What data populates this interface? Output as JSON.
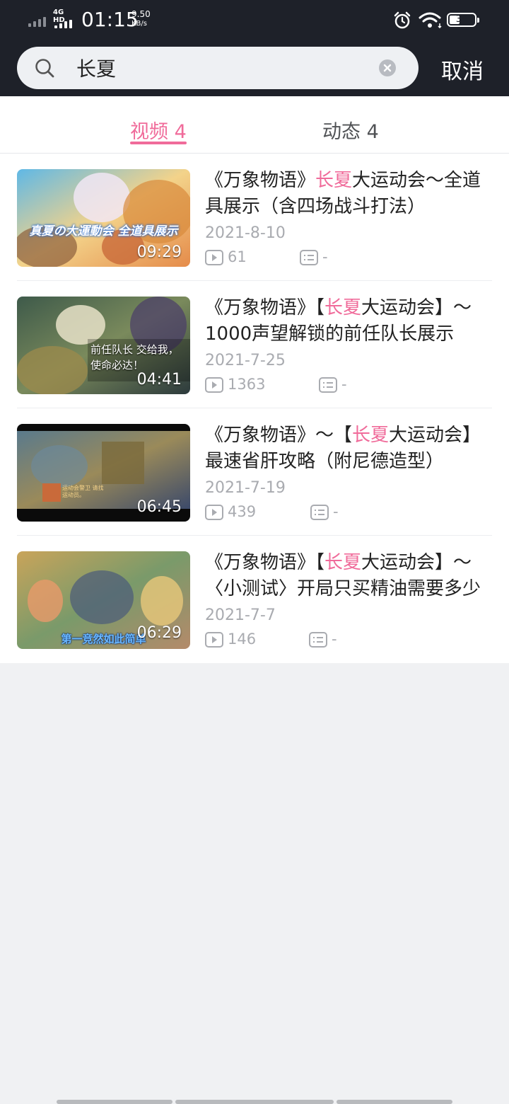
{
  "status": {
    "network": "4G HD",
    "time": "01:15",
    "speed_value": "9.50",
    "speed_unit": "KB/s",
    "battery": "38"
  },
  "search": {
    "query": "长夏",
    "cancel_label": "取消"
  },
  "tabs": [
    {
      "label": "视频 4",
      "active": true
    },
    {
      "label": "动态 4",
      "active": false
    }
  ],
  "results": [
    {
      "title_pre": "《万象物语》",
      "title_hl": "长夏",
      "title_post": "大运动会～全道具展示（含四场战斗打法）",
      "duration": "09:29",
      "thumb_text": "真夏の大運動会 全道具展示",
      "date": "2021-8-10",
      "plays": "61",
      "comments": "-"
    },
    {
      "title_pre": "《万象物语》【",
      "title_hl": "长夏",
      "title_post": "大运动会】～1000声望解锁的前任队长展示",
      "duration": "04:41",
      "thumb_text": "前任队长 交给我，使命必达！",
      "date": "2021-7-25",
      "plays": "1363",
      "comments": "-"
    },
    {
      "title_pre": "《万象物语》～【",
      "title_hl": "长夏",
      "title_post": "大运动会】最速省肝攻略（附尼德造型）",
      "duration": "06:45",
      "thumb_text": "运动会警卫 请找运动员。",
      "date": "2021-7-19",
      "plays": "439",
      "comments": "-"
    },
    {
      "title_pre": "《万象物语》【",
      "title_hl": "长夏",
      "title_post": "大运动会】～〈小测试〉开局只买精油需要多少",
      "duration": "06:29",
      "thumb_text": "第一竞然如此简单",
      "date": "2021-7-7",
      "plays": "146",
      "comments": "-"
    }
  ],
  "colors": {
    "accent": "#f06b9a",
    "topbar": "#1e2129",
    "meta_text": "#a9abb0"
  },
  "icons": [
    "search-icon",
    "clear-icon",
    "play-icon",
    "comment-icon",
    "alarm-icon",
    "wifi-icon",
    "battery-icon"
  ]
}
